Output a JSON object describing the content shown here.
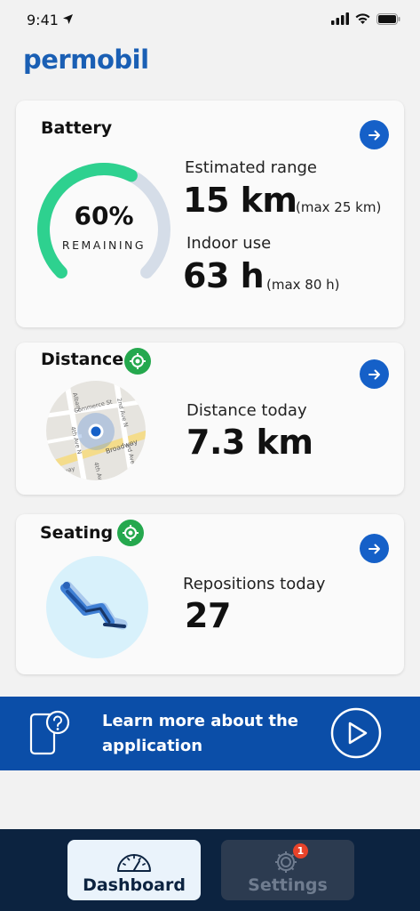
{
  "status": {
    "time": "9:41"
  },
  "brand": {
    "logo_text": "permobil"
  },
  "battery": {
    "title": "Battery",
    "percent_text": "60%",
    "percent_value": 60,
    "remaining_label": "REMAINING",
    "range_label": "Estimated range",
    "range_value": "15 km",
    "range_max": "(max 25 km)",
    "indoor_label": "Indoor use",
    "indoor_value": "63 h",
    "indoor_max": "(max 80 h)"
  },
  "distance": {
    "title": "Distance",
    "label": "Distance today",
    "value": "7.3 km",
    "map_streets": [
      "Albany",
      "Commerce St",
      "2nd Ave N",
      "4th Ave N",
      "3rd Ave",
      "Broadway",
      "4th Ave",
      "way"
    ]
  },
  "seating": {
    "title": "Seating",
    "label": "Repositions today",
    "value": "27"
  },
  "banner": {
    "text": "Learn more about the application"
  },
  "tabs": {
    "dashboard": "Dashboard",
    "settings": "Settings",
    "settings_badge": "1"
  },
  "colors": {
    "accent": "#1560c8",
    "gauge": "#2ed18f",
    "gauge_track": "#d5dde8",
    "locate_badge": "#25a84e",
    "banner": "#0b4ea8",
    "tabbar": "#0c2340",
    "badge": "#e8432a"
  }
}
